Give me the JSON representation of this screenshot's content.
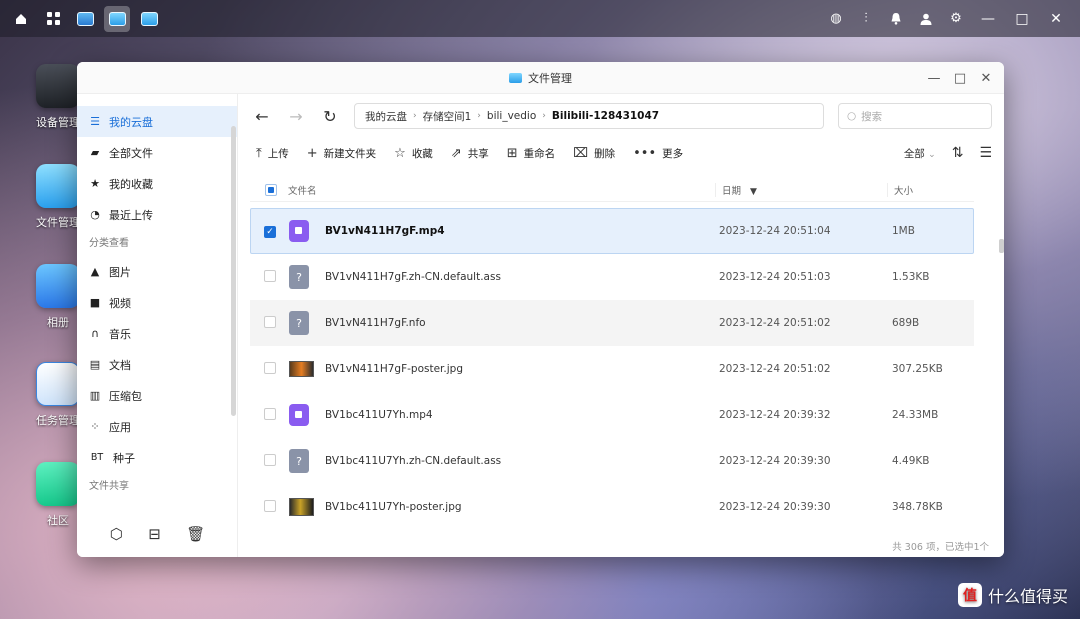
{
  "taskbar": {
    "right_icons": [
      "globe-icon",
      "plug-icon",
      "bell-icon",
      "user-icon",
      "gear-icon"
    ],
    "window_controls": [
      "—",
      "□",
      "✕"
    ]
  },
  "desktop": {
    "icons": [
      {
        "label": "设备管理"
      },
      {
        "label": "文件管理"
      },
      {
        "label": "相册"
      },
      {
        "label": "任务管理"
      },
      {
        "label": "社区"
      }
    ]
  },
  "window": {
    "title": "文件管理",
    "controls": [
      "—",
      "□",
      "✕"
    ]
  },
  "sidebar": {
    "items": [
      {
        "label": "我的云盘",
        "icon": "cloud-disk-icon"
      },
      {
        "label": "全部文件",
        "icon": "folder-icon"
      },
      {
        "label": "我的收藏",
        "icon": "star-icon"
      },
      {
        "label": "最近上传",
        "icon": "clock-icon"
      }
    ],
    "section_category": "分类查看",
    "categories": [
      {
        "label": "图片",
        "icon": "image-icon"
      },
      {
        "label": "视频",
        "icon": "video-icon"
      },
      {
        "label": "音乐",
        "icon": "headphones-icon"
      },
      {
        "label": "文档",
        "icon": "document-icon"
      },
      {
        "label": "压缩包",
        "icon": "archive-icon"
      },
      {
        "label": "应用",
        "icon": "apps-icon"
      },
      {
        "label": "种子",
        "icon": "torrent-icon",
        "prefix": "BT"
      }
    ],
    "section_share": "文件共享"
  },
  "nav": {
    "breadcrumb": [
      "我的云盘",
      "存储空间1",
      "bili_vedio",
      "Bilibili-128431047"
    ],
    "search_placeholder": "搜索"
  },
  "toolbar": {
    "upload": "上传",
    "new_folder": "新建文件夹",
    "favorite": "收藏",
    "share": "共享",
    "rename": "重命名",
    "delete": "删除",
    "more": "更多",
    "filter": "全部"
  },
  "table": {
    "col_name": "文件名",
    "col_date": "日期",
    "col_size": "大小",
    "rows": [
      {
        "name": "BV1vN411H7gF.mp4",
        "date": "2023-12-24 20:51:04",
        "size": "1MB",
        "type": "video"
      },
      {
        "name": "BV1vN411H7gF.zh-CN.default.ass",
        "date": "2023-12-24 20:51:03",
        "size": "1.53KB",
        "type": "unknown"
      },
      {
        "name": "BV1vN411H7gF.nfo",
        "date": "2023-12-24 20:51:02",
        "size": "689B",
        "type": "unknown"
      },
      {
        "name": "BV1vN411H7gF-poster.jpg",
        "date": "2023-12-24 20:51:02",
        "size": "307.25KB",
        "type": "image"
      },
      {
        "name": "BV1bc411U7Yh.mp4",
        "date": "2023-12-24 20:39:32",
        "size": "24.33MB",
        "type": "video"
      },
      {
        "name": "BV1bc411U7Yh.zh-CN.default.ass",
        "date": "2023-12-24 20:39:30",
        "size": "4.49KB",
        "type": "unknown"
      },
      {
        "name": "BV1bc411U7Yh-poster.jpg",
        "date": "2023-12-24 20:39:30",
        "size": "348.78KB",
        "type": "image"
      }
    ]
  },
  "status": "共 306 项，已选中1个",
  "watermark": {
    "badge": "值",
    "text": "什么值得买"
  },
  "colors": {
    "accent": "#1a6fd8",
    "selected_bg": "#e6f0fc",
    "video_icon": "#8a5cf0"
  }
}
